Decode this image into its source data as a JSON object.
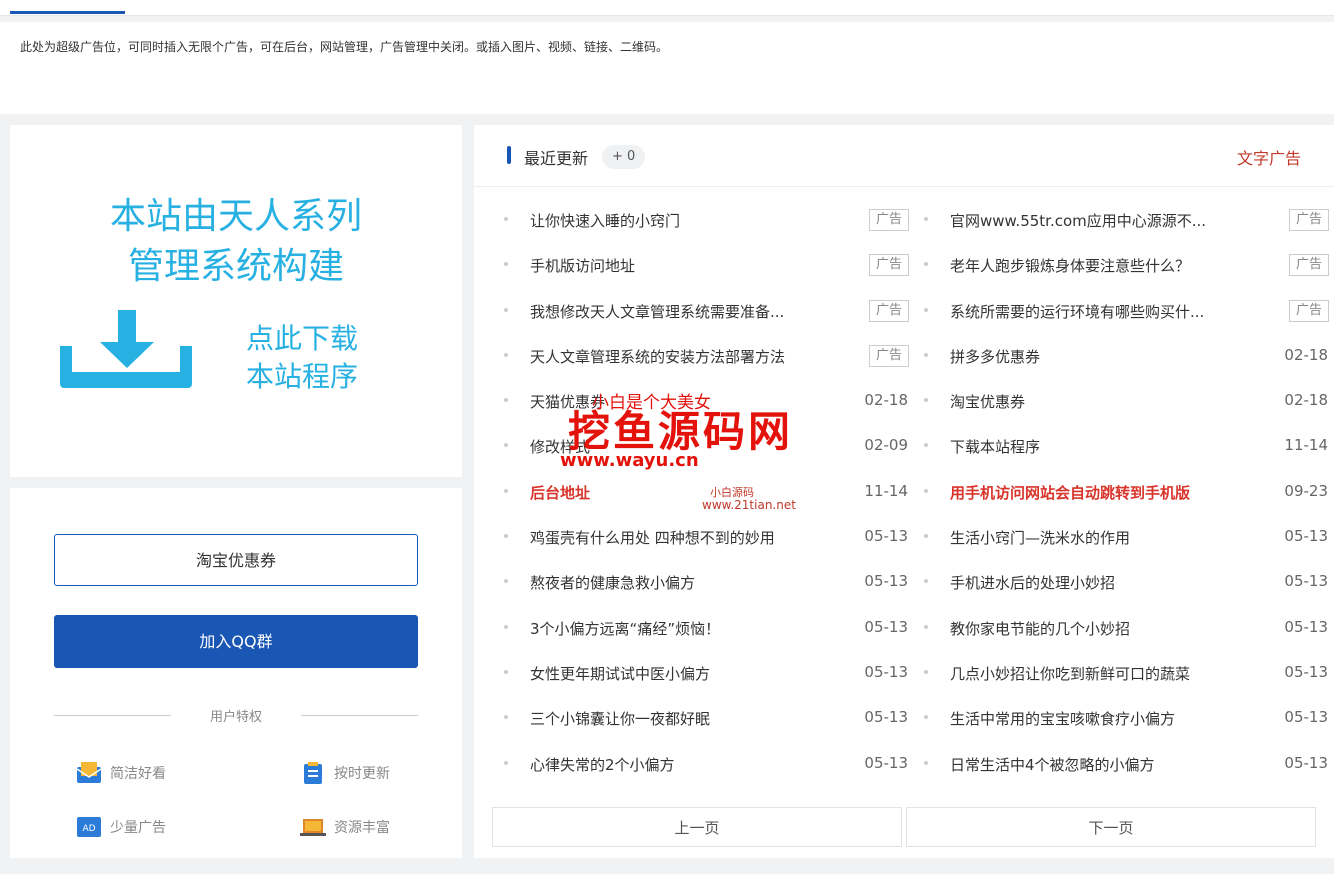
{
  "adbar": {
    "text": "此处为超级广告位，可同时插入无限个广告，可在后台，网站管理，广告管理中关闭。或插入图片、视频、链接、二维码。"
  },
  "banner": {
    "line1": "本站由天人系列",
    "line2": "管理系统构建",
    "download_line1": "点此下载",
    "download_line2": "本站程序",
    "icon": "download-icon",
    "color": "#27b0e2"
  },
  "sidebox": {
    "coupon_label": "淘宝优惠券",
    "qq_label": "加入QQ群",
    "privileges_label": "用户特权",
    "features": [
      {
        "label": "简洁好看",
        "icon": "envelope-icon"
      },
      {
        "label": "按时更新",
        "icon": "clipboard-icon"
      },
      {
        "label": "少量广告",
        "icon": "ad-icon"
      },
      {
        "label": "资源丰富",
        "icon": "laptop-icon"
      }
    ],
    "accent": "#1a57b4"
  },
  "news": {
    "title": "最近更新",
    "count": "+ 0",
    "ad_link": "文字广告",
    "left": [
      {
        "title": "让你快速入睡的小窍门",
        "tag": "广告"
      },
      {
        "title": "手机版访问地址",
        "tag": "广告"
      },
      {
        "title": "我想修改天人文章管理系统需要准备...",
        "tag": "广告"
      },
      {
        "title": "天人文章管理系统的安装方法部署方法",
        "tag": "广告"
      },
      {
        "title": "天猫优惠券",
        "date": "02-18"
      },
      {
        "title": "修改样式",
        "date": "02-09"
      },
      {
        "title": "后台地址",
        "date": "11-14",
        "highlight": true
      },
      {
        "title": "鸡蛋壳有什么用处 四种想不到的妙用",
        "date": "05-13"
      },
      {
        "title": "熬夜者的健康急救小偏方",
        "date": "05-13"
      },
      {
        "title": "3个小偏方远离“痛经”烦恼！",
        "date": "05-13"
      },
      {
        "title": "女性更年期试试中医小偏方",
        "date": "05-13"
      },
      {
        "title": "三个小锦囊让你一夜都好眠",
        "date": "05-13"
      },
      {
        "title": "心律失常的2个小偏方",
        "date": "05-13"
      }
    ],
    "right": [
      {
        "title": "官网www.55tr.com应用中心源源不...",
        "tag": "广告"
      },
      {
        "title": "老年人跑步锻炼身体要注意些什么？",
        "tag": "广告"
      },
      {
        "title": "系统所需要的运行环境有哪些购买什...",
        "tag": "广告"
      },
      {
        "title": "拼多多优惠券",
        "date": "02-18"
      },
      {
        "title": "淘宝优惠券",
        "date": "02-18"
      },
      {
        "title": "下载本站程序",
        "date": "11-14"
      },
      {
        "title": "用手机访问网站会自动跳转到手机版",
        "date": "09-23",
        "highlight": true
      },
      {
        "title": "生活小窍门—洗米水的作用",
        "date": "05-13"
      },
      {
        "title": "手机进水后的处理小妙招",
        "date": "05-13"
      },
      {
        "title": "教你家电节能的几个小妙招",
        "date": "05-13"
      },
      {
        "title": "几点小妙招让你吃到新鲜可口的蔬菜",
        "date": "05-13"
      },
      {
        "title": "生活中常用的宝宝咳嗽食疗小偏方",
        "date": "05-13"
      },
      {
        "title": "日常生活中4个被忽略的小偏方",
        "date": "05-13"
      }
    ],
    "prev_label": "上一页",
    "next_label": "下一页",
    "highlight_color": "#d9342b"
  },
  "watermark": {
    "big": "挖鱼源码网",
    "url": "www.wayu.cn",
    "small1": "小白是个大美女",
    "small2": "小白源码",
    "small3": "www.21tian.net",
    "color": "#e3120b"
  }
}
